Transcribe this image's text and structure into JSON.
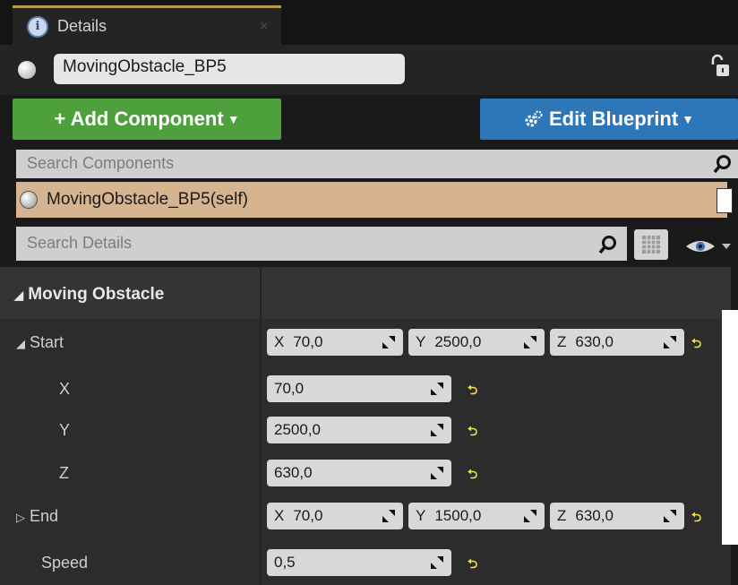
{
  "tab": {
    "title": "Details",
    "close": "×"
  },
  "actor": {
    "name": "MovingObstacle_BP5"
  },
  "toolbar": {
    "add_component": "+ Add Component",
    "edit_blueprint": "Edit Blueprint"
  },
  "components": {
    "search_placeholder": "Search Components",
    "self_item": "MovingObstacle_BP5(self)"
  },
  "details": {
    "search_placeholder": "Search Details"
  },
  "category": {
    "label": "Moving Obstacle"
  },
  "properties": {
    "start": {
      "label": "Start",
      "x_prefix": "X",
      "x": "70,0",
      "y_prefix": "Y",
      "y": "2500,0",
      "z_prefix": "Z",
      "z": "630,0"
    },
    "start_x": {
      "label": "X",
      "value": "70,0"
    },
    "start_y": {
      "label": "Y",
      "value": "2500,0"
    },
    "start_z": {
      "label": "Z",
      "value": "630,0"
    },
    "end": {
      "label": "End",
      "x_prefix": "X",
      "x": "70,0",
      "y_prefix": "Y",
      "y": "1500,0",
      "z_prefix": "Z",
      "z": "630,0"
    },
    "speed": {
      "label": "Speed",
      "value": "0,5"
    }
  },
  "colors": {
    "add_button": "#4ea03c",
    "edit_button": "#2d77b8",
    "component_row": "#d6b48f",
    "reset_arrow": "#f3e23a",
    "tab_accent": "#b79a4a"
  },
  "icons": {
    "tab": "details-info-icon",
    "lock": "padlock-open-icon",
    "search": "magnifier-icon",
    "view": "grid-view-icon",
    "visibility": "eye-icon",
    "reset": "reset-to-default-icon",
    "spin": "drag-spin-icon"
  }
}
